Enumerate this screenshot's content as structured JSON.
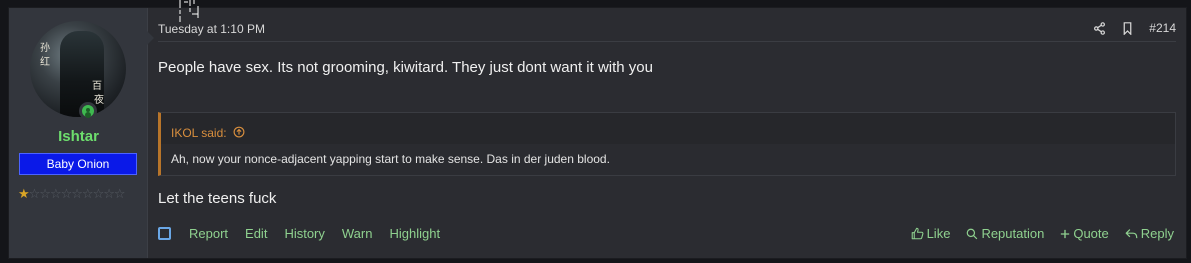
{
  "user": {
    "name": "Ishtar",
    "badge": "Baby Onion",
    "rating_stars_filled": 0.5,
    "rating_stars_total": 10,
    "online": true
  },
  "post": {
    "timestamp": "Tuesday at 1:10 PM",
    "number": "#214",
    "message_1": "People have sex. Its not grooming, kiwitard. They just dont want it with you",
    "quote": {
      "author": "IKOL said:",
      "text": "Ah, now your nonce-adjacent yapping start to make sense. Das in der juden blood."
    },
    "message_2": "Let the teens fuck"
  },
  "actions_left": [
    "Report",
    "Edit",
    "History",
    "Warn",
    "Highlight"
  ],
  "actions_right": {
    "like": "Like",
    "reputation": "Reputation",
    "quote": "Quote",
    "reply": "Reply"
  },
  "colors": {
    "username": "#6ddd6d",
    "badge_bg": "#0a19e8",
    "quote_accent": "#b8752a",
    "action_text": "#8fd18f"
  },
  "icons": [
    "share-icon",
    "bookmark-icon",
    "arrow-up-circle-icon",
    "thumbs-up-icon",
    "search-icon",
    "plus-icon",
    "reply-icon"
  ]
}
